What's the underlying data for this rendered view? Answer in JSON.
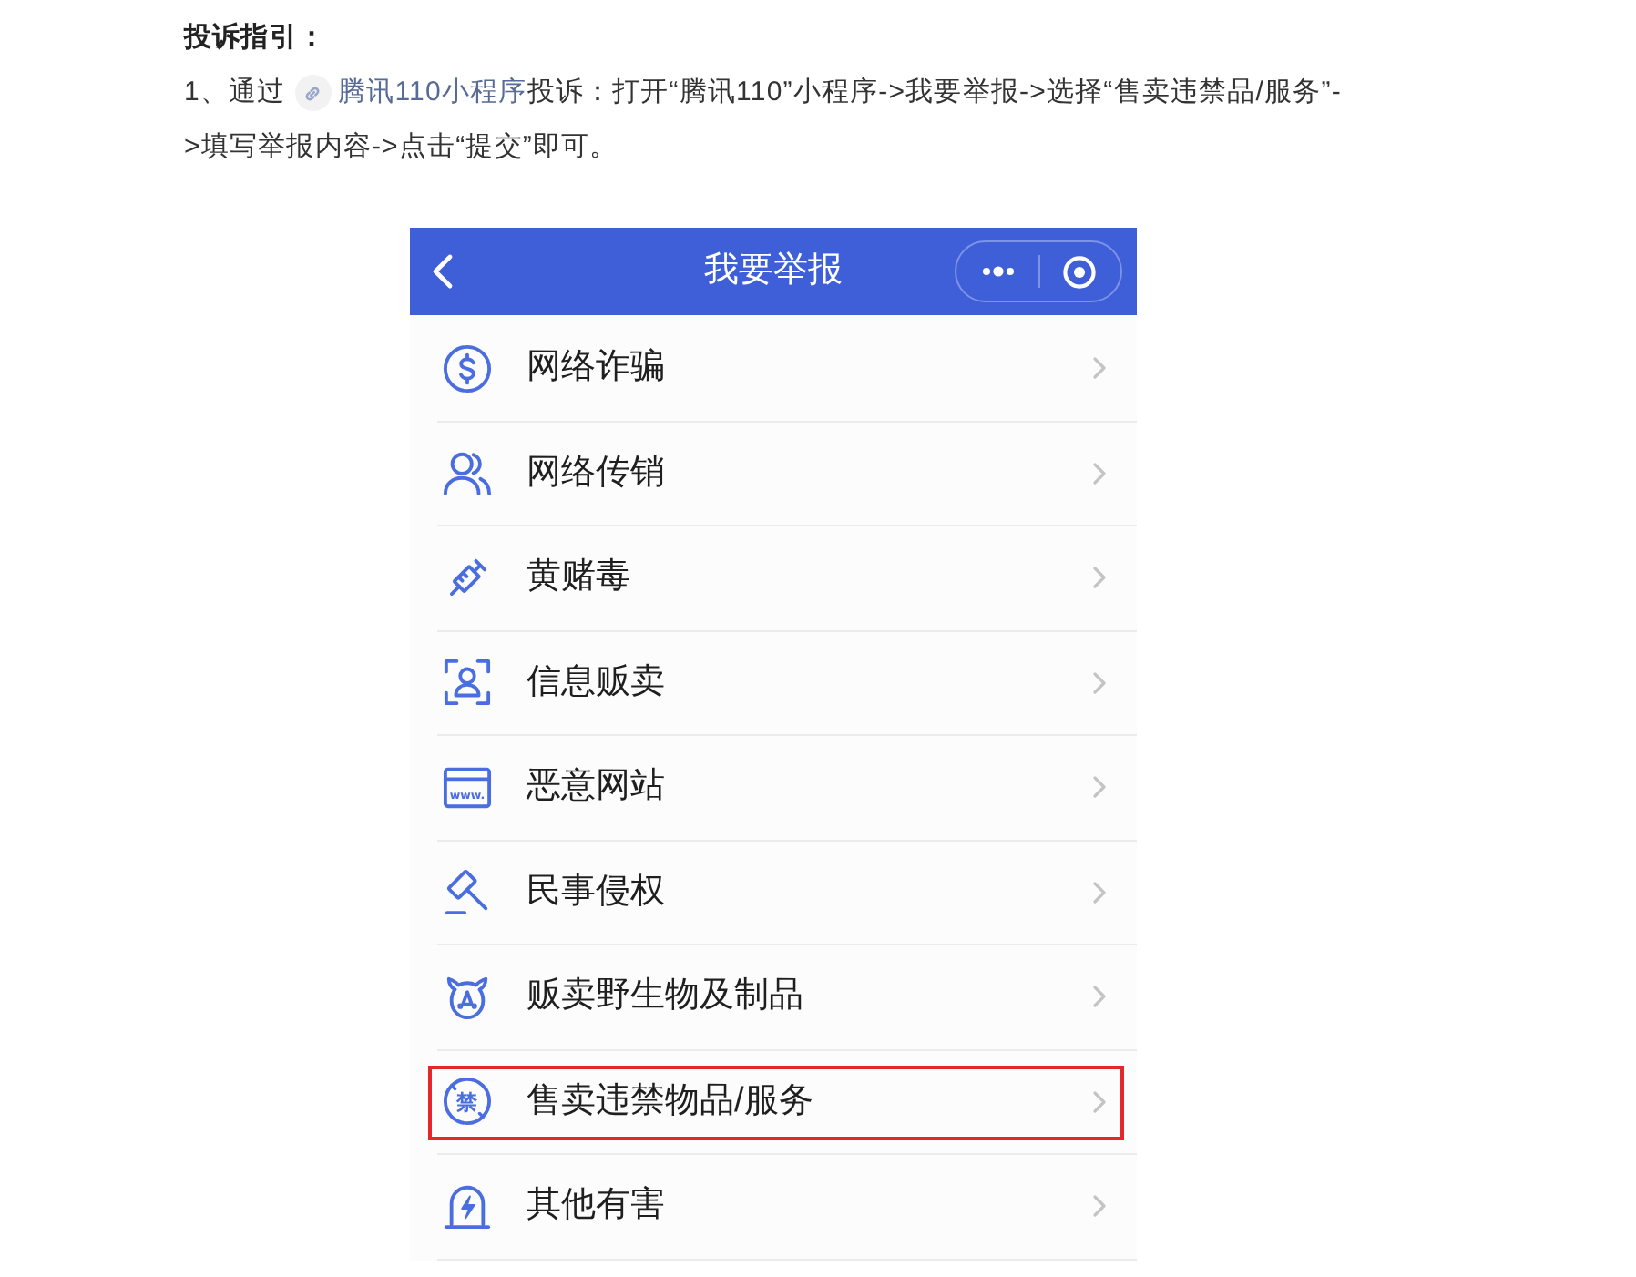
{
  "guide": {
    "heading": "投诉指引：",
    "step": {
      "lead": "1、通过",
      "link": "腾讯110小程序",
      "rest": "投诉：打开“腾讯110”小程序->我要举报->选择“售卖违禁品/服务”->填写举报内容->点击“提交”即可。"
    }
  },
  "screenshot": {
    "title": "我要举报",
    "items": [
      {
        "label": "网络诈骗",
        "highlighted": false
      },
      {
        "label": "网络传销",
        "highlighted": false
      },
      {
        "label": "黄赌毒",
        "highlighted": false
      },
      {
        "label": "信息贩卖",
        "highlighted": false
      },
      {
        "label": "恶意网站",
        "icon_text": "www.",
        "highlighted": false
      },
      {
        "label": "民事侵权",
        "highlighted": false
      },
      {
        "label": "贩卖野生物及制品",
        "highlighted": false
      },
      {
        "label": "售卖违禁物品/服务",
        "icon_text": "禁",
        "highlighted": true
      },
      {
        "label": "其他有害",
        "highlighted": false
      }
    ]
  }
}
